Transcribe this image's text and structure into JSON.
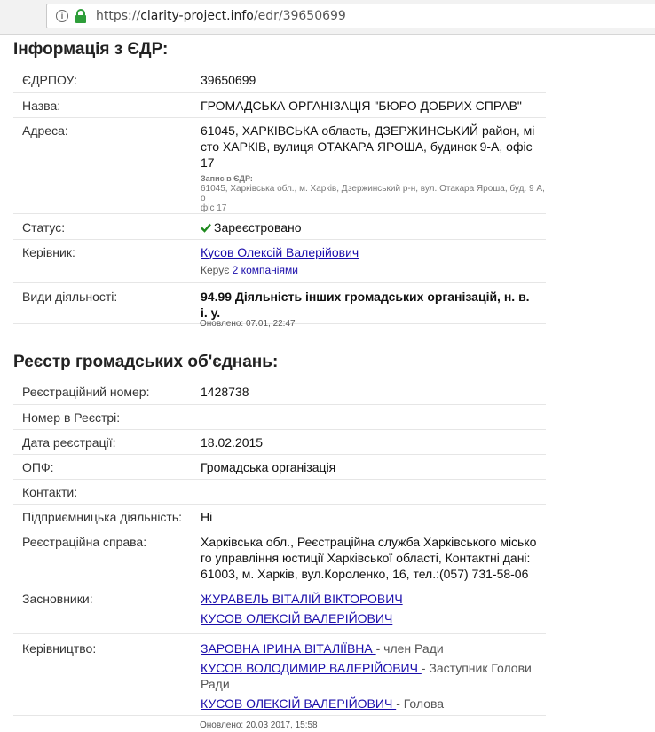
{
  "browser": {
    "url_scheme": "https://",
    "url_host": "clarity-project.info",
    "url_path": "/edr/39650699"
  },
  "edr": {
    "title": "Інформація з ЄДР:",
    "rows": {
      "edrpou": {
        "label": "ЄДРПОУ:",
        "value": "39650699"
      },
      "name": {
        "label": "Назва:",
        "value": "ГРОМАДСЬКА ОРГАНІЗАЦІЯ \"БЮРО ДОБРИХ СПРАВ\""
      },
      "address": {
        "label": "Адреса:",
        "lines": [
          "61045, ХАРКІВСЬКА область, ДЗЕРЖИНСЬКИЙ район, мі",
          "сто ХАРКІВ, вулиця ОТАКАРА ЯРОША, будинок 9-А, офіс",
          "17"
        ],
        "record_title": "Запис в ЄДР:",
        "record_lines": [
          "61045, Харківська обл., м. Харків, Дзержинський р-н, вул. Отакара Яроша, буд. 9 А, о",
          "фіс 17"
        ]
      },
      "status": {
        "label": "Статус:",
        "value": "Зареєстровано"
      },
      "director": {
        "label": "Керівник:",
        "name": "Кусов Олексій Валерійович",
        "manages_prefix": "Керує",
        "manages_link": "2 компаніями"
      },
      "activity": {
        "label": "Види діяльності:",
        "lines": [
          "94.99 Діяльність інших громадських організацій, н. в.",
          "і. у."
        ]
      }
    },
    "updated": "Оновлено: 07.01, 22:47"
  },
  "registry": {
    "title": "Реєстр громадських об'єднань:",
    "rows": {
      "reg_number": {
        "label": "Реєстраційний номер:",
        "value": "1428738"
      },
      "registry_number": {
        "label": "Номер в Реєстрі:",
        "value": ""
      },
      "reg_date": {
        "label": "Дата реєстрації:",
        "value": "18.02.2015"
      },
      "opf": {
        "label": "ОПФ:",
        "value": "Громадська організація"
      },
      "contacts": {
        "label": "Контакти:",
        "value": ""
      },
      "business": {
        "label": "Підприємницька діяльність:",
        "value": "Ні"
      },
      "reg_case": {
        "label": "Реєстраційна справа:",
        "lines": [
          "Харківська обл., Реєстраційна служба Харківського місько",
          "го управління юстиції Харківської області, Контактні дані:",
          "61003, м. Харків, вул.Короленко, 16, тел.:(057) 731-58-06"
        ]
      },
      "founders": {
        "label": "Засновники:",
        "items": [
          "ЖУРАВЕЛЬ ВІТАЛІЙ ВІКТОРОВИЧ",
          "КУСОВ ОЛЕКСІЙ ВАЛЕРІЙОВИЧ"
        ]
      },
      "leadership": {
        "label": "Керівництво:",
        "items": [
          {
            "name": "ЗАРОВНА ІРИНА ВІТАЛІЇВНА ",
            "role": " - член Ради"
          },
          {
            "name": "КУСОВ ВОЛОДИМИР ВАЛЕРІЙОВИЧ ",
            "role": " - Заступник Голови Ради"
          },
          {
            "name": "КУСОВ ОЛЕКСІЙ ВАЛЕРІЙОВИЧ ",
            "role": " - Голова"
          }
        ]
      }
    },
    "updated": "Оновлено: 20.03 2017, 15:58"
  },
  "colors": {
    "link": "#1a0dab",
    "status_ok": "#1e8a1e",
    "lock": "#2e9e3a"
  }
}
